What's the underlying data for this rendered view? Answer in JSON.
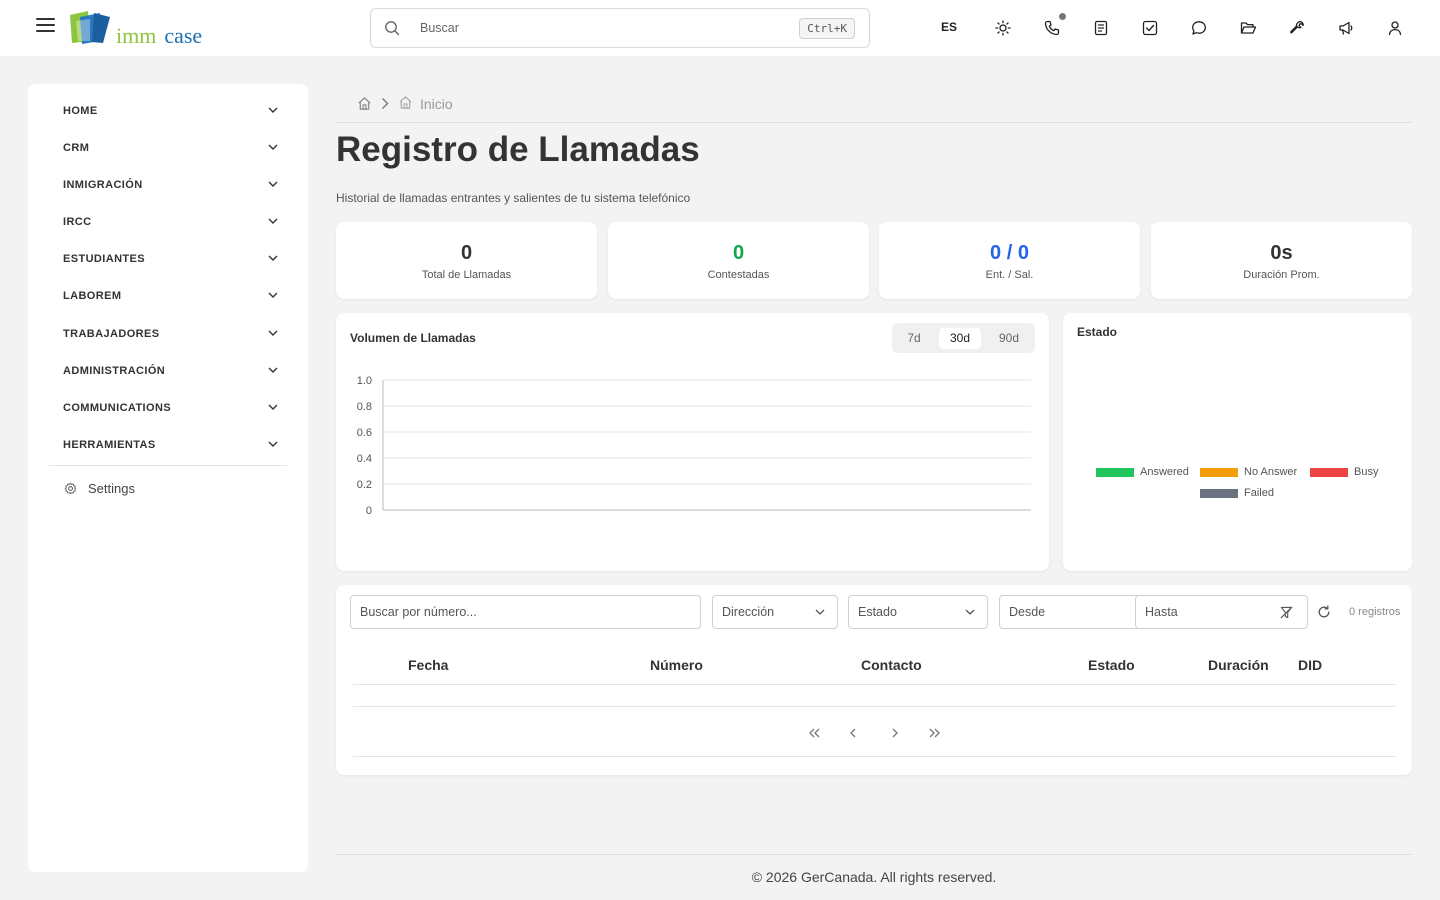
{
  "topbar": {
    "logo": {
      "part1": "imm",
      "part2": "case"
    },
    "search": {
      "placeholder": "Buscar",
      "shortcut": "Ctrl+K"
    },
    "language": "ES",
    "icons": [
      "theme-icon",
      "phone-icon",
      "notes-icon",
      "tasks-icon",
      "chat-icon",
      "folder-icon",
      "tools-icon",
      "megaphone-icon",
      "user-icon"
    ]
  },
  "sidebar": {
    "items": [
      {
        "label": "HOME"
      },
      {
        "label": "CRM"
      },
      {
        "label": "INMIGRACIÓN"
      },
      {
        "label": "IRCC"
      },
      {
        "label": "ESTUDIANTES"
      },
      {
        "label": "LABOREM"
      },
      {
        "label": "TRABAJADORES"
      },
      {
        "label": "ADMINISTRACIÓN"
      },
      {
        "label": "COMMUNICATIONS"
      },
      {
        "label": "HERRAMIENTAS"
      }
    ],
    "settings_label": "Settings"
  },
  "breadcrumb": {
    "current": "Inicio"
  },
  "page": {
    "title": "Registro de Llamadas",
    "subtitle": "Historial de llamadas entrantes y salientes de tu sistema telefónico"
  },
  "stats": [
    {
      "value": "0",
      "label": "Total de Llamadas",
      "color": "#333333"
    },
    {
      "value": "0",
      "label": "Contestadas",
      "color": "#16a34a"
    },
    {
      "value": "0 / 0",
      "label": "Ent. / Sal.",
      "color": "#2563eb"
    },
    {
      "value": "0s",
      "label": "Duración Prom.",
      "color": "#333333"
    }
  ],
  "volume_card": {
    "title": "Volumen de Llamadas",
    "ranges": [
      "7d",
      "30d",
      "90d"
    ],
    "active_range": "30d"
  },
  "status_card": {
    "title": "Estado",
    "legend": [
      {
        "label": "Answered",
        "color": "#22c55e"
      },
      {
        "label": "No Answer",
        "color": "#f59e0b"
      },
      {
        "label": "Busy",
        "color": "#ef4444"
      },
      {
        "label": "Failed",
        "color": "#6b7280"
      }
    ]
  },
  "chart_data": {
    "type": "line",
    "title": "Volumen de Llamadas",
    "xlabel": "",
    "ylabel": "",
    "ylim": [
      0,
      1.0
    ],
    "yticks": [
      "1.0",
      "0.8",
      "0.6",
      "0.4",
      "0.2",
      "0"
    ],
    "series": [],
    "grid": true
  },
  "filters": {
    "search_placeholder": "Buscar por número...",
    "direction_label": "Dirección",
    "status_label": "Estado",
    "from_label": "Desde",
    "to_label": "Hasta",
    "count": "0 registros"
  },
  "table": {
    "columns": [
      "Fecha",
      "Número",
      "Contacto",
      "Estado",
      "Duración",
      "DID"
    ],
    "rows": []
  },
  "footer": "© 2026 GerCanada. All rights reserved."
}
